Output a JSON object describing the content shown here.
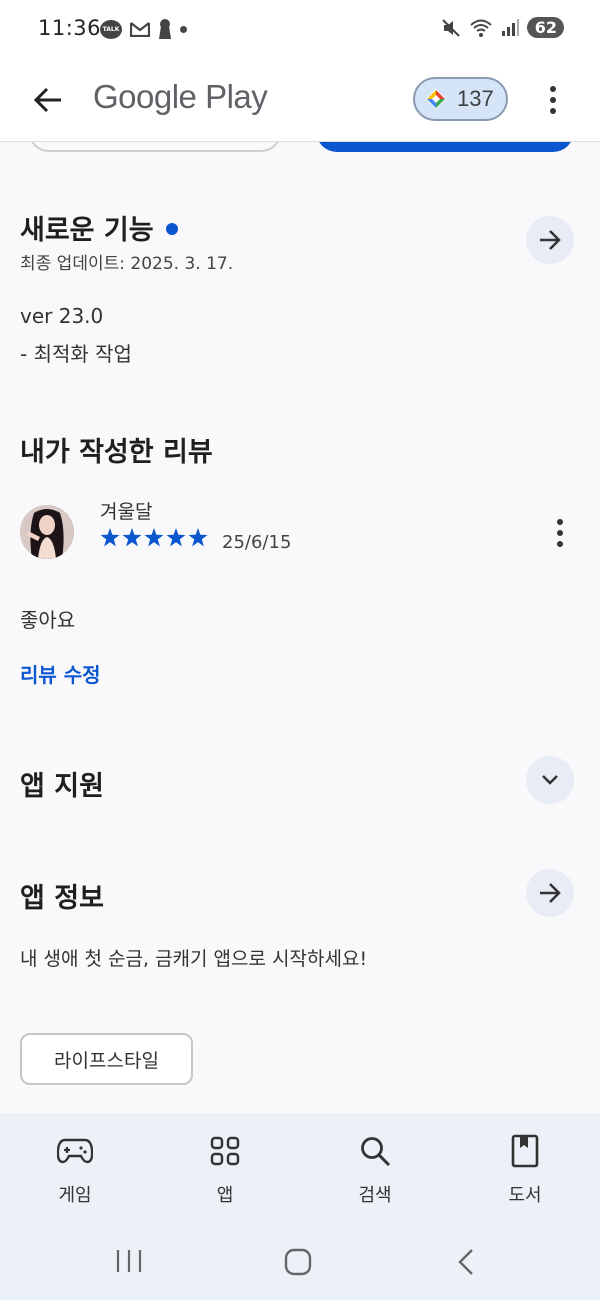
{
  "status_bar": {
    "time": "11:36",
    "talk_badge": "TALK",
    "battery": "62"
  },
  "app_bar": {
    "title": "Google Play",
    "points": "137"
  },
  "whats_new": {
    "title": "새로운 기능",
    "updated": "최종 업데이트: 2025. 3. 17.",
    "version": "ver 23.0",
    "notes": "- 최적화 작업"
  },
  "my_review": {
    "title": "내가 작성한 리뷰",
    "author": "겨울달",
    "rating": 5,
    "date": "25/6/15",
    "text": "좋아요",
    "edit_label": "리뷰 수정"
  },
  "app_support": {
    "title": "앱 지원"
  },
  "app_info": {
    "title": "앱 정보",
    "description": "내 생애 첫 순금, 금캐기 앱으로 시작하세요!",
    "category_chip": "라이프스타일"
  },
  "bottom_nav": {
    "items": [
      {
        "label": "게임",
        "icon": "gamepad-icon"
      },
      {
        "label": "앱",
        "icon": "apps-grid-icon"
      },
      {
        "label": "검색",
        "icon": "search-icon"
      },
      {
        "label": "도서",
        "icon": "book-icon"
      }
    ]
  },
  "colors": {
    "accent": "#0b57d0",
    "nav_bg": "#ecf1f8",
    "points_bg": "#d6e4f8"
  }
}
